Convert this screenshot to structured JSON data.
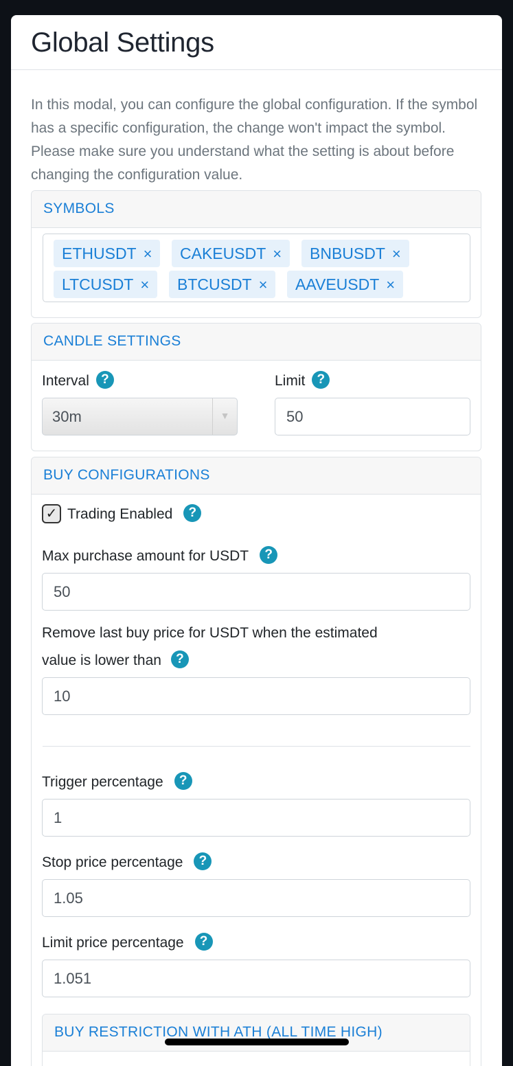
{
  "modal": {
    "title": "Global Settings",
    "intro": "In this modal, you can configure the global configuration. If the symbol has a specific configuration, the change won't impact the symbol. Please make sure you understand what the setting is about before changing the configuration value."
  },
  "symbols": {
    "header": "SYMBOLS",
    "remove_glyph": "×",
    "tags": [
      "ETHUSDT",
      "CAKEUSDT",
      "BNBUSDT",
      "LTCUSDT",
      "BTCUSDT",
      "AAVEUSDT"
    ]
  },
  "candle": {
    "header": "CANDLE SETTINGS",
    "interval_label": "Interval",
    "interval_value": "30m",
    "limit_label": "Limit",
    "limit_value": "50"
  },
  "buy": {
    "header": "BUY CONFIGURATIONS",
    "trading_enabled_label": "Trading Enabled",
    "trading_enabled": true,
    "max_purchase_label": "Max purchase amount for USDT",
    "max_purchase_value": "50",
    "remove_last_buy_label_line1": "Remove last buy price for USDT when the estimated",
    "remove_last_buy_label_line2": "value is lower than",
    "remove_last_buy_value": "10",
    "trigger_label": "Trigger percentage",
    "trigger_value": "1",
    "stop_label": "Stop price percentage",
    "stop_value": "1.05",
    "limit_label": "Limit price percentage",
    "limit_value": "1.051",
    "ath_header": "BUY RESTRICTION WITH ATH (ALL TIME HIGH)"
  },
  "icons": {
    "help": "?",
    "check": "✓",
    "dropdown": "▼"
  },
  "colors": {
    "accent": "#1a7fd6",
    "help_icon": "#1896b7",
    "tag_bg": "#e6f1fb"
  }
}
